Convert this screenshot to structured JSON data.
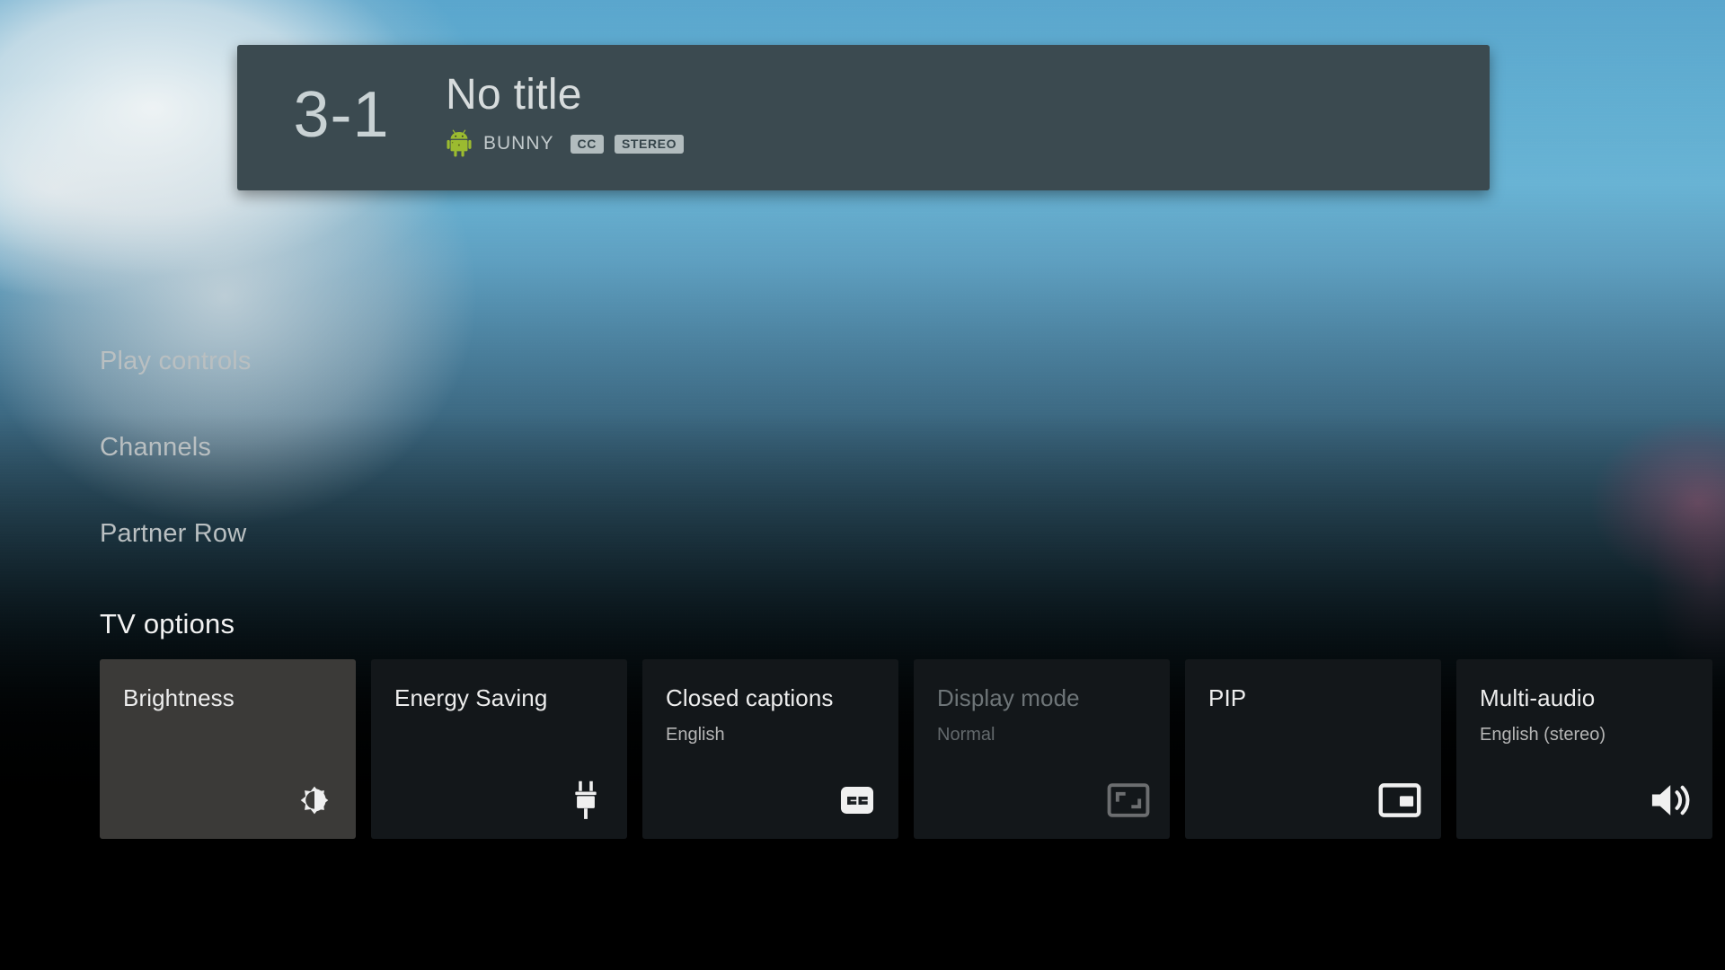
{
  "banner": {
    "channel_number": "3-1",
    "program_title": "No title",
    "channel_name": "BUNNY",
    "app_icon": "android-robot-icon",
    "badges": [
      "CC",
      "STEREO"
    ]
  },
  "rows": [
    {
      "label": "Play controls"
    },
    {
      "label": "Channels"
    },
    {
      "label": "Partner Row"
    }
  ],
  "tv_options": {
    "heading": "TV options",
    "cards": [
      {
        "title": "Brightness",
        "subtitle": "",
        "icon": "brightness-icon",
        "state": "focused"
      },
      {
        "title": "Energy Saving",
        "subtitle": "",
        "icon": "power-plug-icon",
        "state": "normal"
      },
      {
        "title": "Closed captions",
        "subtitle": "English",
        "icon": "closed-caption-icon",
        "state": "normal"
      },
      {
        "title": "Display mode",
        "subtitle": "Normal",
        "icon": "aspect-ratio-icon",
        "state": "disabled"
      },
      {
        "title": "PIP",
        "subtitle": "",
        "icon": "pip-icon",
        "state": "normal"
      },
      {
        "title": "Multi-audio",
        "subtitle": "English (stereo)",
        "icon": "volume-up-icon",
        "state": "normal"
      }
    ]
  },
  "colors": {
    "banner_bg": "#3b4a50",
    "badge_bg": "#b2bcbe",
    "card_bg": "#13171a",
    "card_focused_bg": "#3b3a38",
    "accent_text": "#ededed",
    "disabled_text": "#6e7578"
  }
}
